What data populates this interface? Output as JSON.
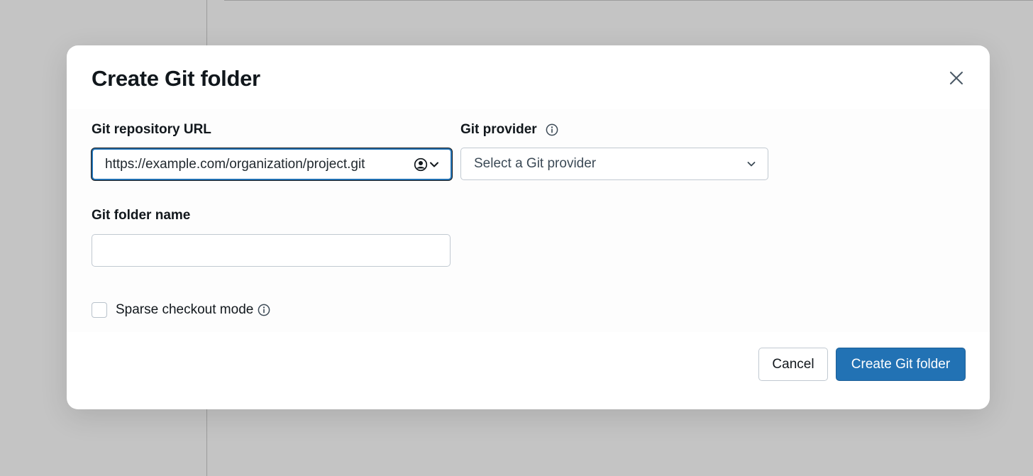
{
  "dialog": {
    "title": "Create Git folder",
    "close_icon": "close-icon"
  },
  "fields": {
    "repo_url": {
      "label": "Git repository URL",
      "value": "https://example.com/organization/project.git",
      "menu_icon": "user-circle-icon"
    },
    "provider": {
      "label": "Git provider",
      "info_icon": "info-icon",
      "placeholder": "Select a Git provider"
    },
    "folder_name": {
      "label": "Git folder name",
      "value": ""
    },
    "sparse_checkout": {
      "label": "Sparse checkout mode",
      "checked": false,
      "info_icon": "info-icon"
    }
  },
  "buttons": {
    "cancel": "Cancel",
    "create": "Create Git folder"
  },
  "colors": {
    "primary": "#2272b4",
    "overlay": "#c4c4c4",
    "text": "#11171c",
    "border": "#c1c9d1"
  }
}
